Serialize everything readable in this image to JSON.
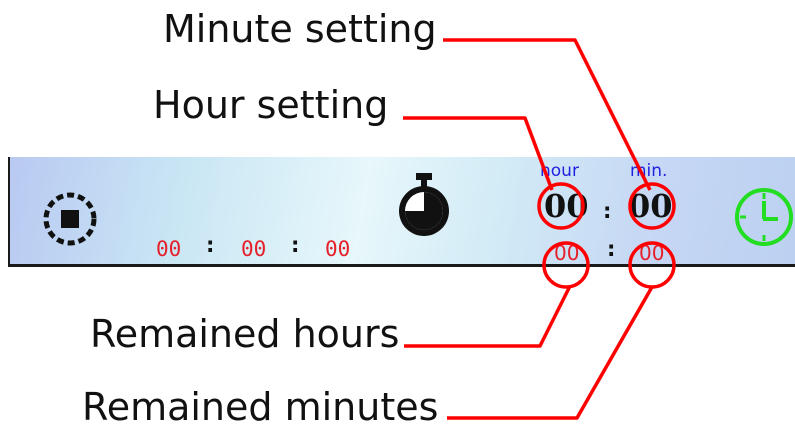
{
  "annotations": {
    "minute_setting": "Minute setting",
    "hour_setting": "Hour setting",
    "remained_hours": "Remained hours",
    "remained_minutes": "Remained minutes"
  },
  "toolbar": {
    "elapsed": {
      "hours": "00",
      "minutes": "00",
      "seconds": "00",
      "separator": ":"
    },
    "setting": {
      "hour_label": "hour",
      "minute_label": "min.",
      "hour": "00",
      "minute": "00",
      "separator": ":"
    },
    "remaining": {
      "hours": "00",
      "minutes": "00",
      "separator": ":"
    }
  },
  "icons": {
    "stop": "stop-icon",
    "stopwatch": "stopwatch-icon",
    "clock": "clock-icon"
  },
  "colors": {
    "callout": "#ff0000",
    "elapsed_text": "#e5202a",
    "unit_label": "#2020e0",
    "clock": "#22dd22"
  }
}
